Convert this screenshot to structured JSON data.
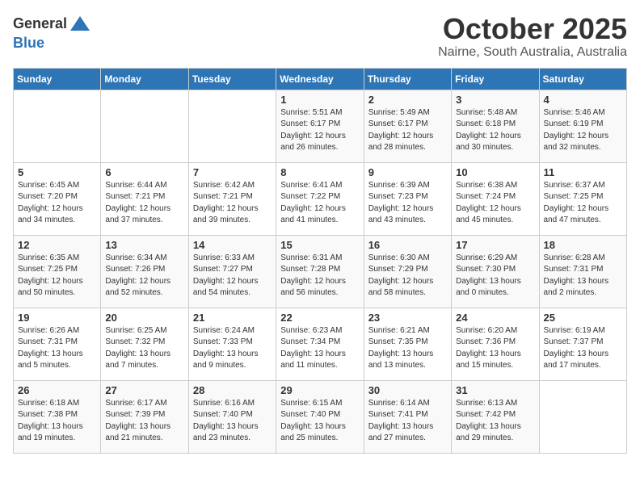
{
  "header": {
    "logo_line1": "General",
    "logo_line2": "Blue",
    "month": "October 2025",
    "location": "Nairne, South Australia, Australia"
  },
  "days_of_week": [
    "Sunday",
    "Monday",
    "Tuesday",
    "Wednesday",
    "Thursday",
    "Friday",
    "Saturday"
  ],
  "weeks": [
    [
      {
        "day": "",
        "content": ""
      },
      {
        "day": "",
        "content": ""
      },
      {
        "day": "",
        "content": ""
      },
      {
        "day": "1",
        "content": "Sunrise: 5:51 AM\nSunset: 6:17 PM\nDaylight: 12 hours\nand 26 minutes."
      },
      {
        "day": "2",
        "content": "Sunrise: 5:49 AM\nSunset: 6:17 PM\nDaylight: 12 hours\nand 28 minutes."
      },
      {
        "day": "3",
        "content": "Sunrise: 5:48 AM\nSunset: 6:18 PM\nDaylight: 12 hours\nand 30 minutes."
      },
      {
        "day": "4",
        "content": "Sunrise: 5:46 AM\nSunset: 6:19 PM\nDaylight: 12 hours\nand 32 minutes."
      }
    ],
    [
      {
        "day": "5",
        "content": "Sunrise: 6:45 AM\nSunset: 7:20 PM\nDaylight: 12 hours\nand 34 minutes."
      },
      {
        "day": "6",
        "content": "Sunrise: 6:44 AM\nSunset: 7:21 PM\nDaylight: 12 hours\nand 37 minutes."
      },
      {
        "day": "7",
        "content": "Sunrise: 6:42 AM\nSunset: 7:21 PM\nDaylight: 12 hours\nand 39 minutes."
      },
      {
        "day": "8",
        "content": "Sunrise: 6:41 AM\nSunset: 7:22 PM\nDaylight: 12 hours\nand 41 minutes."
      },
      {
        "day": "9",
        "content": "Sunrise: 6:39 AM\nSunset: 7:23 PM\nDaylight: 12 hours\nand 43 minutes."
      },
      {
        "day": "10",
        "content": "Sunrise: 6:38 AM\nSunset: 7:24 PM\nDaylight: 12 hours\nand 45 minutes."
      },
      {
        "day": "11",
        "content": "Sunrise: 6:37 AM\nSunset: 7:25 PM\nDaylight: 12 hours\nand 47 minutes."
      }
    ],
    [
      {
        "day": "12",
        "content": "Sunrise: 6:35 AM\nSunset: 7:25 PM\nDaylight: 12 hours\nand 50 minutes."
      },
      {
        "day": "13",
        "content": "Sunrise: 6:34 AM\nSunset: 7:26 PM\nDaylight: 12 hours\nand 52 minutes."
      },
      {
        "day": "14",
        "content": "Sunrise: 6:33 AM\nSunset: 7:27 PM\nDaylight: 12 hours\nand 54 minutes."
      },
      {
        "day": "15",
        "content": "Sunrise: 6:31 AM\nSunset: 7:28 PM\nDaylight: 12 hours\nand 56 minutes."
      },
      {
        "day": "16",
        "content": "Sunrise: 6:30 AM\nSunset: 7:29 PM\nDaylight: 12 hours\nand 58 minutes."
      },
      {
        "day": "17",
        "content": "Sunrise: 6:29 AM\nSunset: 7:30 PM\nDaylight: 13 hours\nand 0 minutes."
      },
      {
        "day": "18",
        "content": "Sunrise: 6:28 AM\nSunset: 7:31 PM\nDaylight: 13 hours\nand 2 minutes."
      }
    ],
    [
      {
        "day": "19",
        "content": "Sunrise: 6:26 AM\nSunset: 7:31 PM\nDaylight: 13 hours\nand 5 minutes."
      },
      {
        "day": "20",
        "content": "Sunrise: 6:25 AM\nSunset: 7:32 PM\nDaylight: 13 hours\nand 7 minutes."
      },
      {
        "day": "21",
        "content": "Sunrise: 6:24 AM\nSunset: 7:33 PM\nDaylight: 13 hours\nand 9 minutes."
      },
      {
        "day": "22",
        "content": "Sunrise: 6:23 AM\nSunset: 7:34 PM\nDaylight: 13 hours\nand 11 minutes."
      },
      {
        "day": "23",
        "content": "Sunrise: 6:21 AM\nSunset: 7:35 PM\nDaylight: 13 hours\nand 13 minutes."
      },
      {
        "day": "24",
        "content": "Sunrise: 6:20 AM\nSunset: 7:36 PM\nDaylight: 13 hours\nand 15 minutes."
      },
      {
        "day": "25",
        "content": "Sunrise: 6:19 AM\nSunset: 7:37 PM\nDaylight: 13 hours\nand 17 minutes."
      }
    ],
    [
      {
        "day": "26",
        "content": "Sunrise: 6:18 AM\nSunset: 7:38 PM\nDaylight: 13 hours\nand 19 minutes."
      },
      {
        "day": "27",
        "content": "Sunrise: 6:17 AM\nSunset: 7:39 PM\nDaylight: 13 hours\nand 21 minutes."
      },
      {
        "day": "28",
        "content": "Sunrise: 6:16 AM\nSunset: 7:40 PM\nDaylight: 13 hours\nand 23 minutes."
      },
      {
        "day": "29",
        "content": "Sunrise: 6:15 AM\nSunset: 7:40 PM\nDaylight: 13 hours\nand 25 minutes."
      },
      {
        "day": "30",
        "content": "Sunrise: 6:14 AM\nSunset: 7:41 PM\nDaylight: 13 hours\nand 27 minutes."
      },
      {
        "day": "31",
        "content": "Sunrise: 6:13 AM\nSunset: 7:42 PM\nDaylight: 13 hours\nand 29 minutes."
      },
      {
        "day": "",
        "content": ""
      }
    ]
  ]
}
